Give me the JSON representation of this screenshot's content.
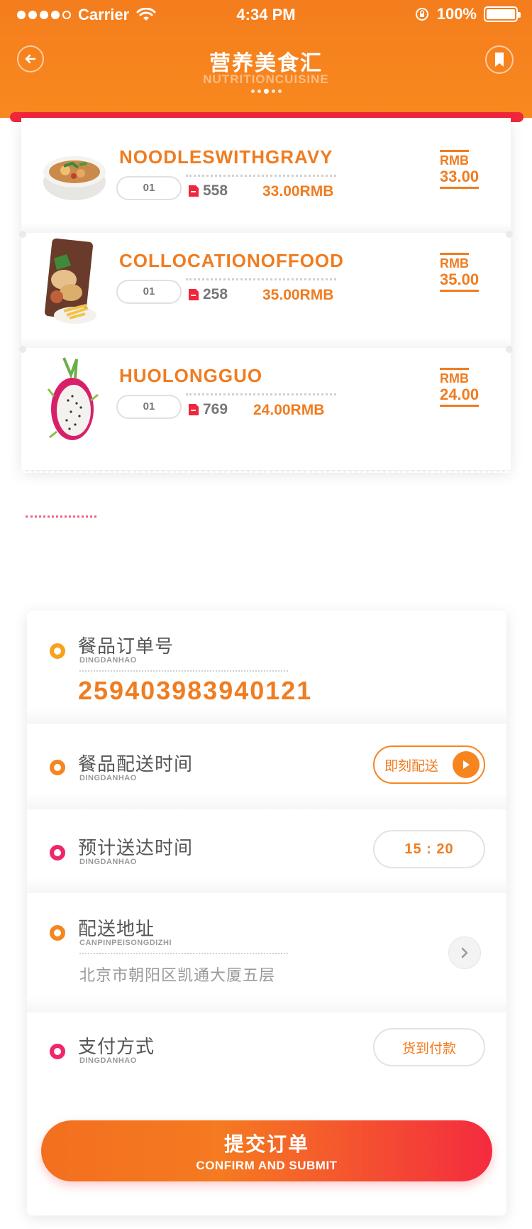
{
  "status_bar": {
    "carrier": "Carrier",
    "time": "4:34 PM",
    "battery": "100%"
  },
  "header": {
    "title": "营养美食汇",
    "subtitle": "NUTRITIONCUISINE"
  },
  "food_items": [
    {
      "name": "NOODLESWITHGRAVY",
      "qty": "01",
      "count": "558",
      "sub_price": "33.00RMB",
      "currency": "RMB",
      "price": "33.00",
      "image": "noodle-bowl"
    },
    {
      "name": "COLLOCATIONOFFOOD",
      "qty": "01",
      "count": "258",
      "sub_price": "35.00RMB",
      "currency": "RMB",
      "price": "35.00",
      "image": "fries-plate"
    },
    {
      "name": "HUOLONGGUO",
      "qty": "01",
      "count": "769",
      "sub_price": "24.00RMB",
      "currency": "RMB",
      "price": "24.00",
      "image": "dragon-fruit"
    }
  ],
  "order": {
    "order_no": {
      "title": "餐品订单号",
      "sub": "DINGDANHAO",
      "value": "259403983940121"
    },
    "delivery_time": {
      "title": "餐品配送时间",
      "sub": "DINGDANHAO",
      "button": "即刻配送"
    },
    "eta": {
      "title": "预计送达时间",
      "sub": "DINGDANHAO",
      "value": "15 : 20"
    },
    "address": {
      "title": "配送地址",
      "sub": "CANPINPEISONGDIZHI",
      "value": "北京市朝阳区凯通大厦五层"
    },
    "payment": {
      "title": "支付方式",
      "sub": "DINGDANHAO",
      "value": "货到付款"
    }
  },
  "submit": {
    "label_cn": "提交订单",
    "label_en": "CONFIRM AND SUBMIT"
  },
  "colors": {
    "brand_orange": "#f6851f",
    "accent_red": "#f0263c",
    "accent_pink": "#f0266b",
    "text_orange": "#f07c20"
  }
}
